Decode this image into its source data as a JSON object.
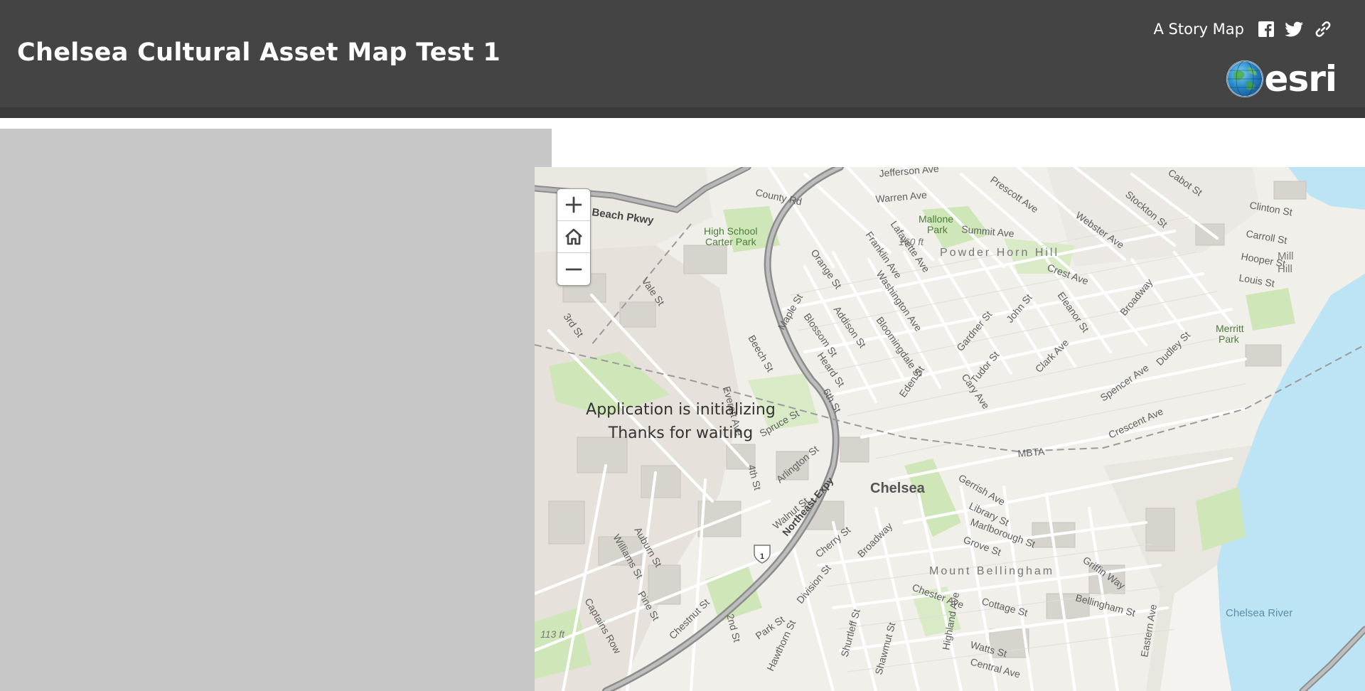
{
  "header": {
    "title": "Chelsea Cultural Asset Map Test 1",
    "story_link": "A Story Map",
    "share_icons": [
      "facebook-icon",
      "twitter-icon",
      "link-icon"
    ],
    "logo_text": "esri"
  },
  "loading": {
    "line1": "Application is initializing",
    "line2": "Thanks for waiting"
  },
  "map": {
    "zoom_controls": [
      "zoom-in",
      "home",
      "zoom-out"
    ],
    "labels": [
      "Jefferson Ave",
      "County Rd",
      "Warren Ave",
      "Beach Pkwy",
      "High School",
      "Carter Park",
      "Mallone",
      "Park",
      "160 ft",
      "Summit Ave",
      "Powder Horn Hill",
      "Prescott Ave",
      "Webster Ave",
      "Stockton St",
      "Cabot St",
      "Clinton St",
      "Carroll St",
      "Hooper St",
      "Mill Hill",
      "Louis St",
      "Crest Ave",
      "Lafayette Ave",
      "Franklin Ave",
      "Orange St",
      "Vale St",
      "3rd St",
      "Washington Ave",
      "Maple St",
      "Addison St",
      "Blossom St",
      "Bloomingdale St",
      "Beech St",
      "Heard St",
      "Gardner St",
      "John St",
      "Eleanor St",
      "Broadway",
      "Merritt",
      "Park",
      "Dudley St",
      "Tudor St",
      "Clark Ave",
      "Cary Ave",
      "Spencer Ave",
      "Crescent Ave",
      "Eden St",
      "6th St",
      "Everett Ave",
      "Spruce St",
      "MBTA",
      "Chelsea",
      "Arlington St",
      "4th St",
      "Northeast Expy",
      "Walnut St",
      "Gerrish Ave",
      "Library St",
      "Marlborough St",
      "Grove St",
      "Mount Bellingham",
      "Cherry St",
      "Griffin Way",
      "Williams St",
      "Auburn St",
      "Division St",
      "Chester Ave",
      "Cottage St",
      "Bellingham St",
      "Chelsea River",
      "Captains Row",
      "Pine St",
      "Chestnut St",
      "2nd St",
      "Park St",
      "Hawthorn St",
      "Shurtleff St",
      "Shawmut St",
      "Highland Ave",
      "Watts St",
      "Central Ave",
      "Eastern Ave",
      "113 ft",
      "1"
    ]
  },
  "colors": {
    "header_bg": "#444444",
    "side_panel": "#c7c7c7",
    "water": "#bde4f4",
    "park": "#cfe6b8"
  }
}
